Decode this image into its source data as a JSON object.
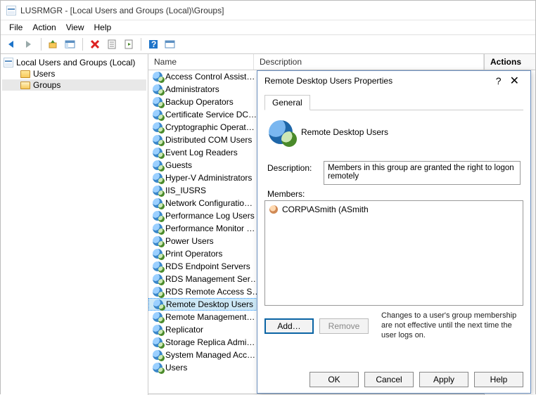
{
  "titlebar": "LUSRMGR - [Local Users and Groups (Local)\\Groups]",
  "menu": {
    "file": "File",
    "action": "Action",
    "view": "View",
    "help": "Help"
  },
  "tree": {
    "root": "Local Users and Groups (Local)",
    "users": "Users",
    "groups": "Groups"
  },
  "columns": {
    "name": "Name",
    "description": "Description"
  },
  "actions_header": "Actions",
  "groups": [
    "Access Control Assist…",
    "Administrators",
    "Backup Operators",
    "Certificate Service DC…",
    "Cryptographic Operat…",
    "Distributed COM Users",
    "Event Log Readers",
    "Guests",
    "Hyper-V Administrators",
    "IIS_IUSRS",
    "Network Configuratio…",
    "Performance Log Users",
    "Performance Monitor …",
    "Power Users",
    "Print Operators",
    "RDS Endpoint Servers",
    "RDS Management Ser…",
    "RDS Remote Access S…",
    "Remote Desktop Users",
    "Remote Management…",
    "Replicator",
    "Storage Replica Admi…",
    "System Managed Acc…",
    "Users"
  ],
  "selected_index": 18,
  "dialog": {
    "title": "Remote Desktop Users Properties",
    "tab": "General",
    "group_name": "Remote Desktop Users",
    "desc_label": "Description:",
    "description": "Members in this group are granted the right to logon remotely",
    "members_label": "Members:",
    "members": [
      "CORP\\ASmith (ASmith"
    ],
    "add": "Add…",
    "remove": "Remove",
    "note": "Changes to a user's group membership are not effective until the next time the user logs on.",
    "ok": "OK",
    "cancel": "Cancel",
    "apply": "Apply",
    "help": "Help"
  }
}
